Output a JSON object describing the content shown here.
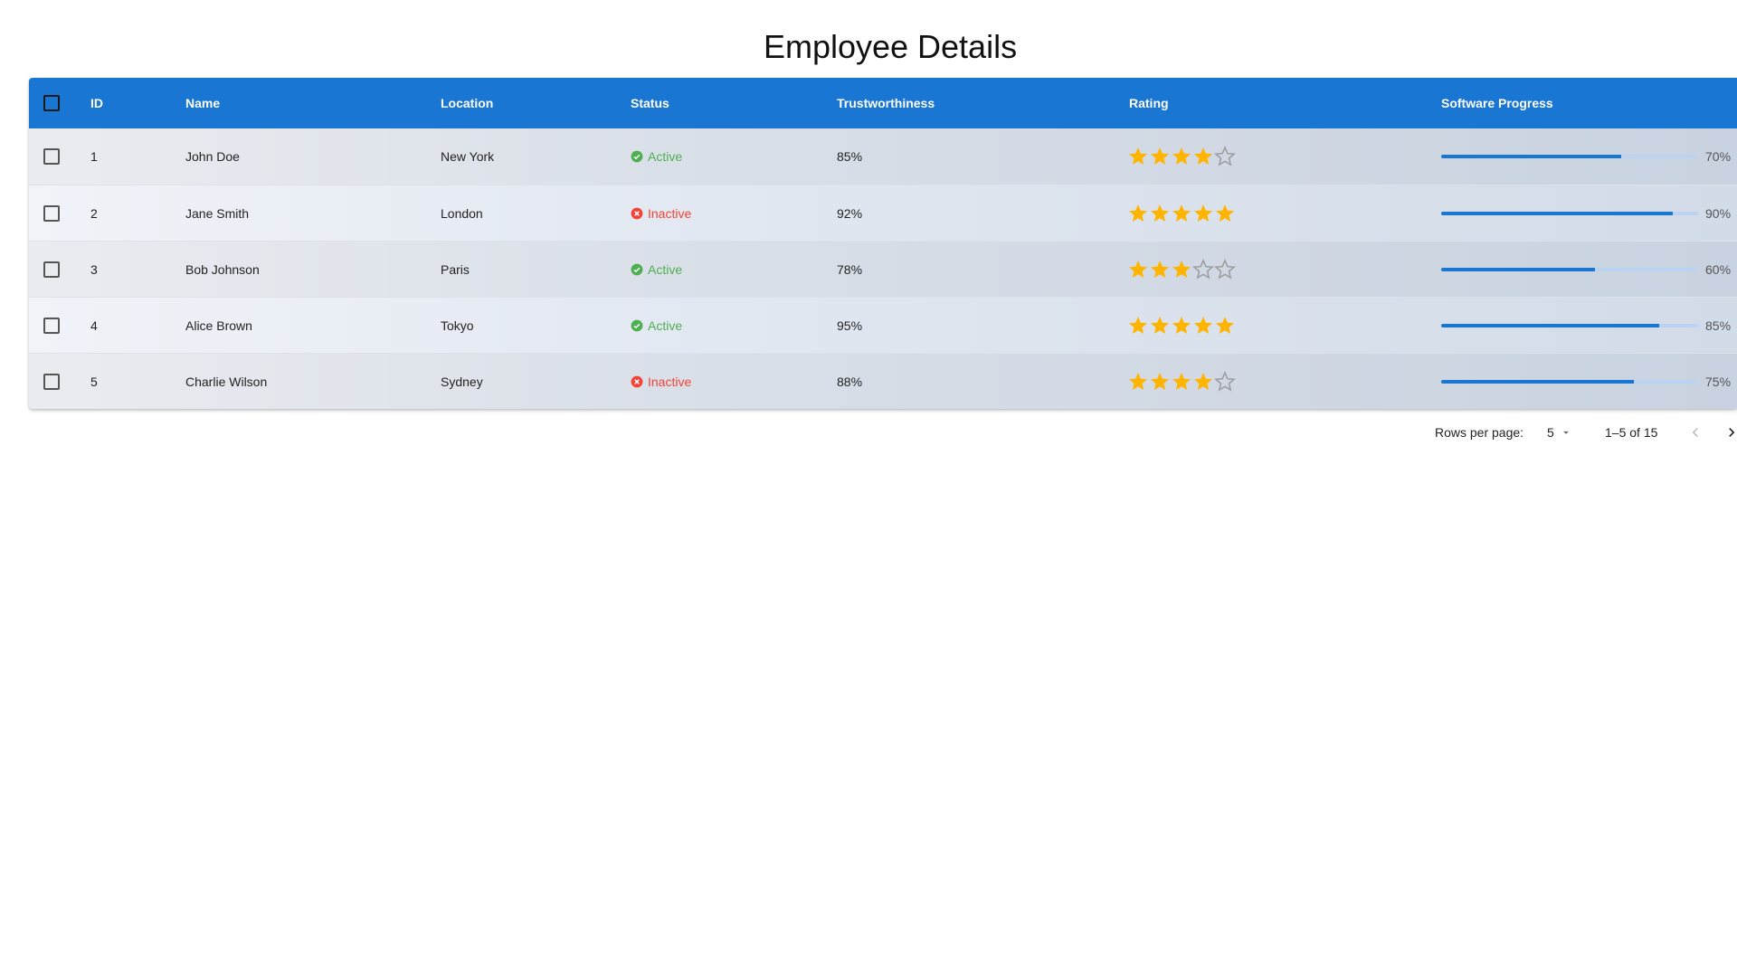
{
  "page": {
    "title": "Employee Details"
  },
  "table": {
    "columns": {
      "id": "ID",
      "name": "Name",
      "location": "Location",
      "status": "Status",
      "trust": "Trustworthiness",
      "rating": "Rating",
      "progress": "Software Progress"
    },
    "rows": [
      {
        "id": "1",
        "name": "John Doe",
        "location": "New York",
        "status": "Active",
        "trust": "85%",
        "rating": 4,
        "progress": 70,
        "progress_label": "70%"
      },
      {
        "id": "2",
        "name": "Jane Smith",
        "location": "London",
        "status": "Inactive",
        "trust": "92%",
        "rating": 5,
        "progress": 90,
        "progress_label": "90%"
      },
      {
        "id": "3",
        "name": "Bob Johnson",
        "location": "Paris",
        "status": "Active",
        "trust": "78%",
        "rating": 3,
        "progress": 60,
        "progress_label": "60%"
      },
      {
        "id": "4",
        "name": "Alice Brown",
        "location": "Tokyo",
        "status": "Active",
        "trust": "95%",
        "rating": 5,
        "progress": 85,
        "progress_label": "85%"
      },
      {
        "id": "5",
        "name": "Charlie Wilson",
        "location": "Sydney",
        "status": "Inactive",
        "trust": "88%",
        "rating": 4,
        "progress": 75,
        "progress_label": "75%"
      }
    ]
  },
  "pagination": {
    "rows_per_page_label": "Rows per page:",
    "rows_per_page_value": "5",
    "range_label": "1–5 of 15"
  },
  "colors": {
    "header": "#1976d2",
    "active": "#4caf50",
    "inactive": "#f44336",
    "star_filled": "#ffb400",
    "star_empty": "#9e9e9e",
    "progress_fill": "#1976d2",
    "progress_track": "#b9d3f0"
  },
  "icons": {
    "active": "check-circle-icon",
    "inactive": "cancel-circle-icon",
    "star": "star-icon",
    "star_empty": "star-outline-icon",
    "dropdown": "caret-down-icon",
    "prev": "chevron-left-icon",
    "next": "chevron-right-icon"
  }
}
